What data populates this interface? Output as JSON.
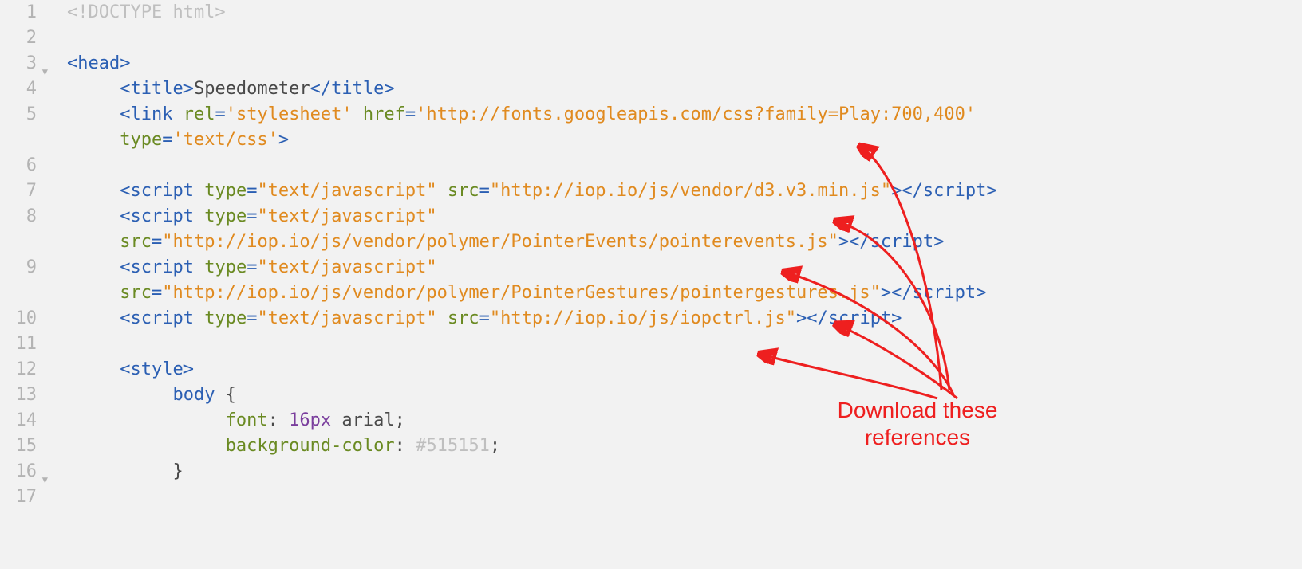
{
  "gutter": {
    "lines": [
      "1",
      "2",
      "3",
      "4",
      "5",
      "6",
      "7",
      "8",
      "9",
      "10",
      "11",
      "12",
      "13",
      "14",
      "15",
      "16",
      "17"
    ],
    "fold_rows": [
      2,
      15
    ]
  },
  "code": {
    "lines": [
      [
        {
          "cls": "t-doctype",
          "t": "<!DOCTYPE html>"
        }
      ],
      [],
      [
        {
          "cls": "t-tag",
          "t": "<head>"
        }
      ],
      [
        {
          "indent": 1
        },
        {
          "cls": "t-tag",
          "t": "<title>"
        },
        {
          "cls": "t-text",
          "t": "Speedometer"
        },
        {
          "cls": "t-tag",
          "t": "</title>"
        }
      ],
      [
        {
          "indent": 1
        },
        {
          "cls": "t-tag",
          "t": "<link "
        },
        {
          "cls": "t-attr",
          "t": "rel"
        },
        {
          "cls": "t-tag",
          "t": "="
        },
        {
          "cls": "t-str",
          "t": "'stylesheet'"
        },
        {
          "cls": "t-tag",
          "t": " "
        },
        {
          "cls": "t-attr",
          "t": "href"
        },
        {
          "cls": "t-tag",
          "t": "="
        },
        {
          "cls": "t-str",
          "t": "'http://fonts.googleapis.com/css?family=Play:700,400'"
        }
      ],
      [
        {
          "indent": 1,
          "wrap": true
        },
        {
          "cls": "t-attr",
          "t": "type"
        },
        {
          "cls": "t-tag",
          "t": "="
        },
        {
          "cls": "t-str",
          "t": "'text/css'"
        },
        {
          "cls": "t-tag",
          "t": ">"
        }
      ],
      [],
      [
        {
          "indent": 1
        },
        {
          "cls": "t-tag",
          "t": "<script "
        },
        {
          "cls": "t-attr",
          "t": "type"
        },
        {
          "cls": "t-tag",
          "t": "="
        },
        {
          "cls": "t-str",
          "t": "\"text/javascript\""
        },
        {
          "cls": "t-tag",
          "t": " "
        },
        {
          "cls": "t-attr",
          "t": "src"
        },
        {
          "cls": "t-tag",
          "t": "="
        },
        {
          "cls": "t-str",
          "t": "\"http://iop.io/js/vendor/d3.v3.min.js\""
        },
        {
          "cls": "t-tag",
          "t": ">"
        },
        {
          "cls": "t-tag",
          "t": "</script>"
        }
      ],
      [
        {
          "indent": 1
        },
        {
          "cls": "t-tag",
          "t": "<script "
        },
        {
          "cls": "t-attr",
          "t": "type"
        },
        {
          "cls": "t-tag",
          "t": "="
        },
        {
          "cls": "t-str",
          "t": "\"text/javascript\""
        }
      ],
      [
        {
          "indent": 1,
          "wrap": true
        },
        {
          "cls": "t-attr",
          "t": "src"
        },
        {
          "cls": "t-tag",
          "t": "="
        },
        {
          "cls": "t-str",
          "t": "\"http://iop.io/js/vendor/polymer/PointerEvents/pointerevents.js\""
        },
        {
          "cls": "t-tag",
          "t": ">"
        },
        {
          "cls": "t-tag",
          "t": "</script>"
        }
      ],
      [
        {
          "indent": 1
        },
        {
          "cls": "t-tag",
          "t": "<script "
        },
        {
          "cls": "t-attr",
          "t": "type"
        },
        {
          "cls": "t-tag",
          "t": "="
        },
        {
          "cls": "t-str",
          "t": "\"text/javascript\""
        }
      ],
      [
        {
          "indent": 1,
          "wrap": true
        },
        {
          "cls": "t-attr",
          "t": "src"
        },
        {
          "cls": "t-tag",
          "t": "="
        },
        {
          "cls": "t-str",
          "t": "\"http://iop.io/js/vendor/polymer/PointerGestures/pointergestures.js\""
        },
        {
          "cls": "t-tag",
          "t": ">"
        },
        {
          "cls": "t-tag",
          "t": "</script>"
        }
      ],
      [
        {
          "indent": 1
        },
        {
          "cls": "t-tag",
          "t": "<script "
        },
        {
          "cls": "t-attr",
          "t": "type"
        },
        {
          "cls": "t-tag",
          "t": "="
        },
        {
          "cls": "t-str",
          "t": "\"text/javascript\""
        },
        {
          "cls": "t-tag",
          "t": " "
        },
        {
          "cls": "t-attr",
          "t": "src"
        },
        {
          "cls": "t-tag",
          "t": "="
        },
        {
          "cls": "t-str",
          "t": "\"http://iop.io/js/iopctrl.js\""
        },
        {
          "cls": "t-tag",
          "t": ">"
        },
        {
          "cls": "t-tag",
          "t": "</script>"
        }
      ],
      [],
      [
        {
          "indent": 1
        },
        {
          "cls": "t-tag",
          "t": "<style>"
        }
      ],
      [
        {
          "indent": 2
        },
        {
          "cls": "t-sel",
          "t": "body"
        },
        {
          "cls": "t-text",
          "t": " {"
        }
      ],
      [
        {
          "indent": 3
        },
        {
          "cls": "t-prop",
          "t": "font"
        },
        {
          "cls": "t-text",
          "t": ": "
        },
        {
          "cls": "t-num",
          "t": "16px"
        },
        {
          "cls": "t-text",
          "t": " "
        },
        {
          "cls": "t-val",
          "t": "arial"
        },
        {
          "cls": "t-text",
          "t": ";"
        }
      ],
      [
        {
          "indent": 3
        },
        {
          "cls": "t-prop",
          "t": "background-color"
        },
        {
          "cls": "t-text",
          "t": ": "
        },
        {
          "cls": "t-col",
          "t": "#515151"
        },
        {
          "cls": "t-text",
          "t": ";"
        }
      ],
      [
        {
          "indent": 2
        },
        {
          "cls": "t-text",
          "t": "}"
        }
      ],
      []
    ]
  },
  "annotation": {
    "text_line1": "Download these",
    "text_line2": "references"
  }
}
